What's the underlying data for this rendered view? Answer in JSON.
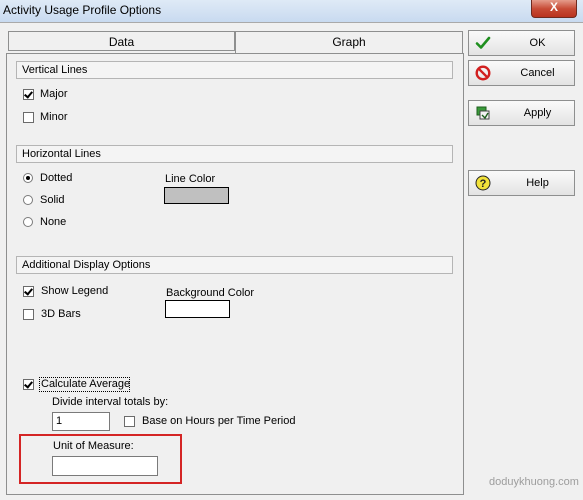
{
  "window": {
    "title": "Activity Usage Profile Options",
    "close_label": "X"
  },
  "tabs": [
    {
      "label": "Data",
      "selected": false
    },
    {
      "label": "Graph",
      "selected": true
    }
  ],
  "vertical_lines": {
    "header": "Vertical Lines",
    "major": {
      "label": "Major",
      "checked": true
    },
    "minor": {
      "label": "Minor",
      "checked": false
    }
  },
  "horizontal_lines": {
    "header": "Horizontal Lines",
    "options": [
      {
        "label": "Dotted",
        "selected": true
      },
      {
        "label": "Solid",
        "selected": false
      },
      {
        "label": "None",
        "selected": false
      }
    ],
    "line_color_label": "Line Color",
    "line_color": "#c0c0c0"
  },
  "additional": {
    "header": "Additional Display Options",
    "show_legend": {
      "label": "Show Legend",
      "checked": true
    },
    "bars_3d": {
      "label": "3D Bars",
      "checked": false
    },
    "background_color_label": "Background Color",
    "background_color": "#ffffff",
    "calculate_average": {
      "label": "Calculate Average",
      "checked": true
    },
    "divide_label": "Divide interval totals by:",
    "divide_value": "1",
    "base_on_hours": {
      "label": "Base on Hours per Time Period",
      "checked": false
    },
    "unit_label": "Unit of Measure:",
    "unit_value": ""
  },
  "buttons": {
    "ok": "OK",
    "cancel": "Cancel",
    "apply": "Apply",
    "help": "Help"
  },
  "watermark": "doduykhuong.com",
  "colors": {
    "highlight": "#d42525",
    "ok_icon": "#1f8f1f",
    "cancel_icon": "#d11f1f"
  }
}
